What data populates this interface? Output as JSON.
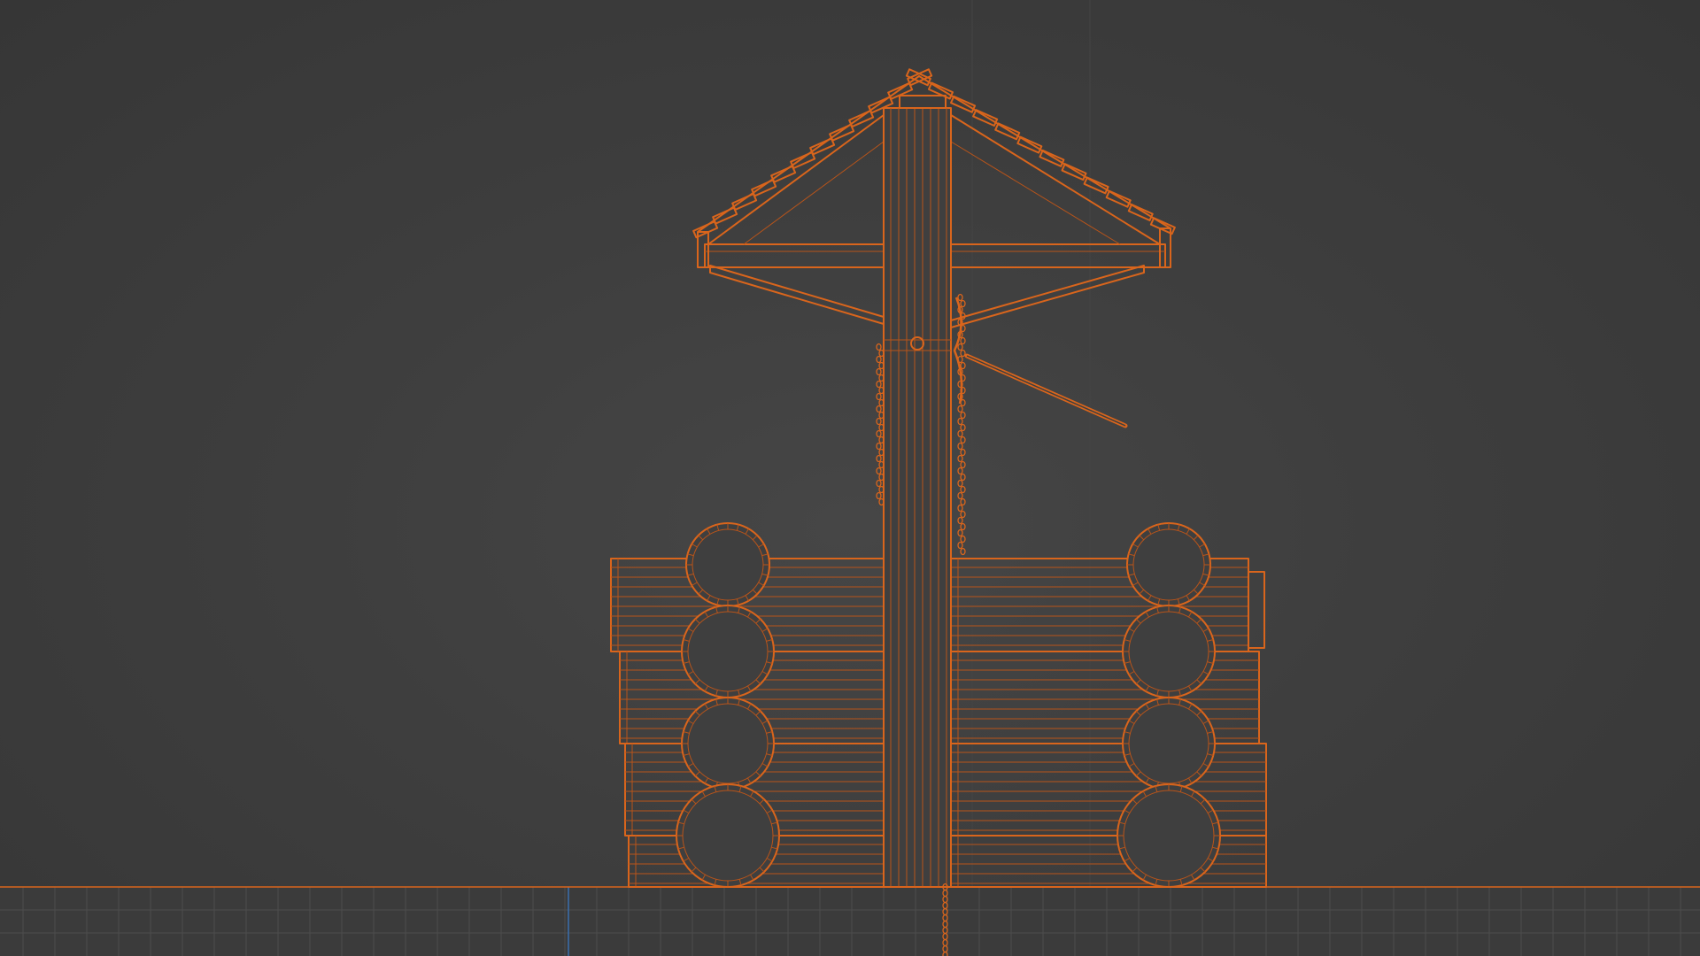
{
  "viewport": {
    "view": "front-orthographic-wireframe",
    "object": "wooden-well",
    "selected": true
  },
  "colors": {
    "wire": "#d9651c",
    "wire_dim": "#b8541a",
    "background": "#3f3f3f",
    "grid": "#4c4c4c",
    "grid_axis": "#3a6fb0",
    "ground_line": "#d9651c"
  }
}
